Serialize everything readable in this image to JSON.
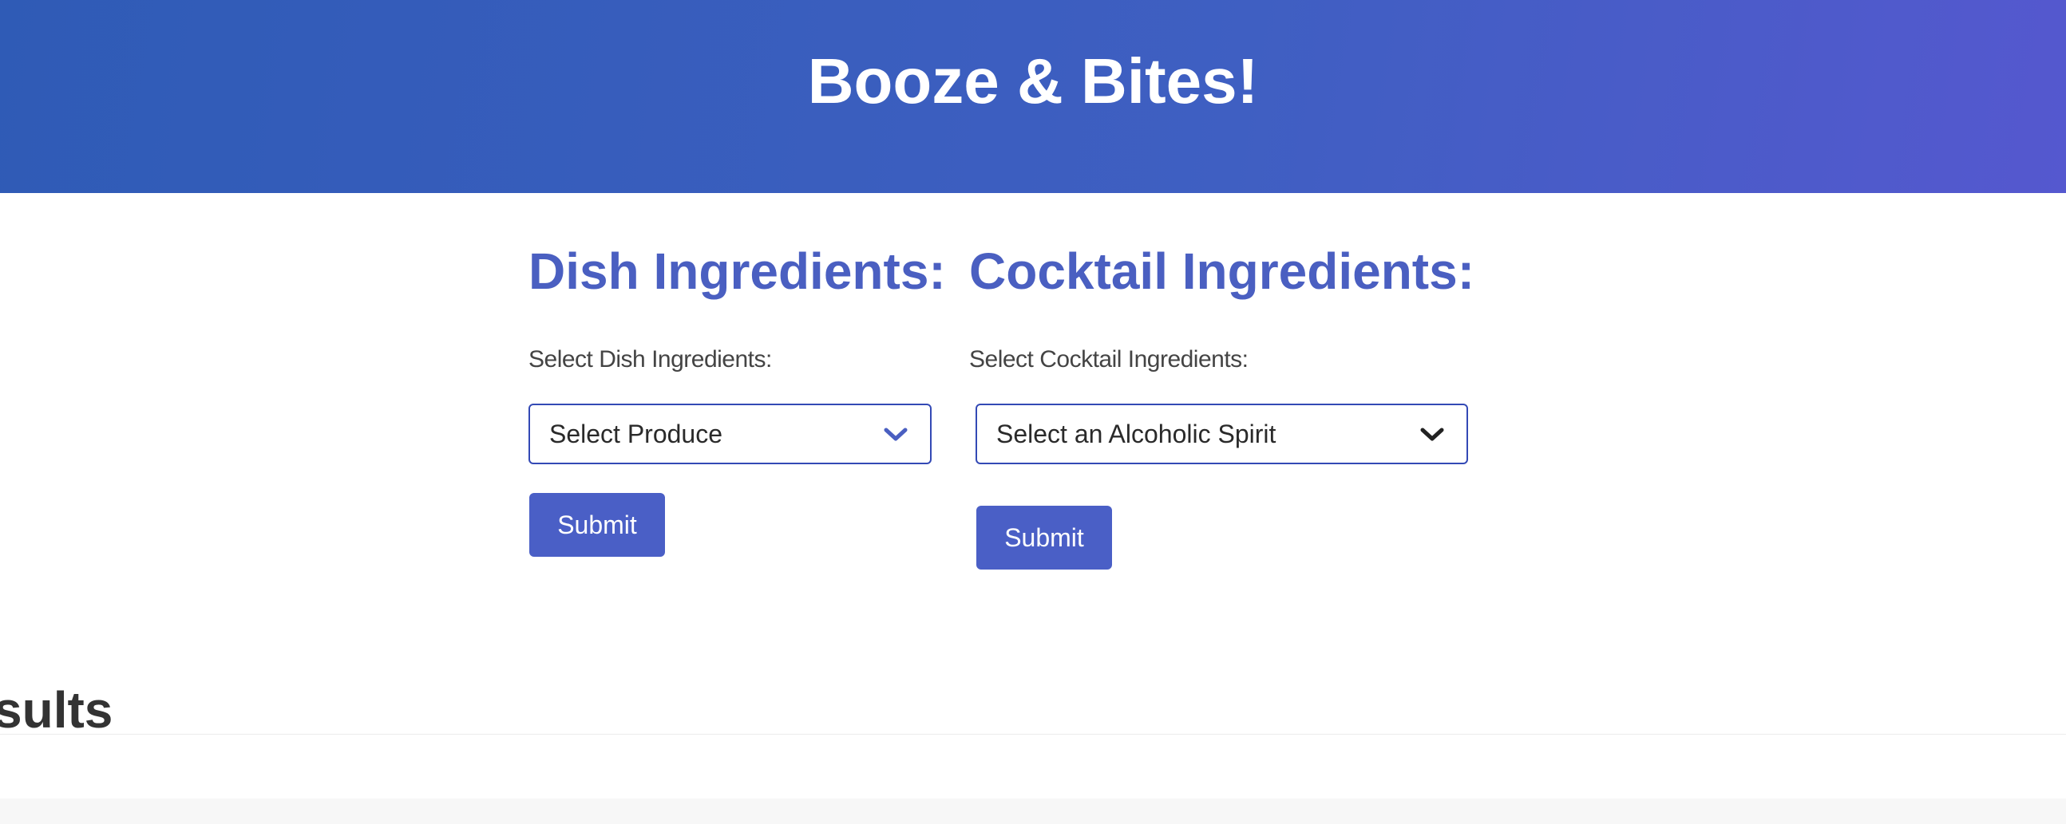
{
  "header": {
    "title": "Booze & Bites!"
  },
  "dish": {
    "heading": "Dish Ingredients:",
    "label": "Select Dish Ingredients:",
    "select_value": "Select Produce",
    "submit_label": "Submit"
  },
  "cocktail": {
    "heading": "Cocktail Ingredients:",
    "label": "Select Cocktail Ingredients:",
    "select_value": "Select an Alcoholic Spirit",
    "submit_label": "Submit"
  },
  "results": {
    "title_visible": "sults"
  },
  "colors": {
    "header_gradient_start": "#2f5bb6",
    "header_gradient_end": "#5558cf",
    "accent": "#4a5fc1",
    "button": "#4a5fc6",
    "select_border": "#3349b5"
  },
  "icons": {
    "dish_select": "chevron-down-icon",
    "cocktail_select": "chevron-down-icon"
  }
}
